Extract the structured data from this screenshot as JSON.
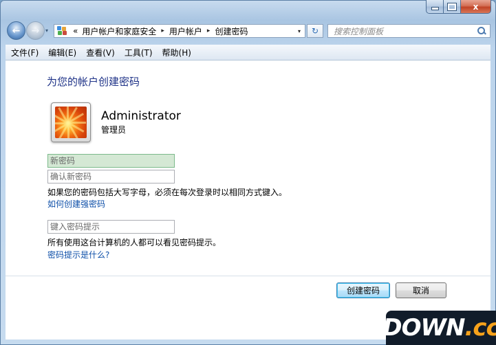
{
  "window": {
    "caption_buttons": {
      "minimize_icon": "minimize-icon",
      "maximize_icon": "maximize-icon",
      "close_glyph": "x"
    }
  },
  "nav": {
    "back_glyph": "←",
    "forward_glyph": "→",
    "recent_glyph": "▾",
    "overflow_glyph": "«",
    "breadcrumbs": [
      "用户帐户和家庭安全",
      "用户帐户",
      "创建密码"
    ],
    "crumb_separator": "▸",
    "dropdown_glyph": "▾",
    "refresh_glyph": "↻",
    "search_placeholder": "搜索控制面板"
  },
  "menu": {
    "items": [
      "文件(F)",
      "编辑(E)",
      "查看(V)",
      "工具(T)",
      "帮助(H)"
    ]
  },
  "main": {
    "heading": "为您的帐户创建密码",
    "user": {
      "name": "Administrator",
      "role": "管理员"
    },
    "fields": {
      "new_password_placeholder": "新密码",
      "confirm_password_placeholder": "确认新密码",
      "hint_placeholder": "键入密码提示"
    },
    "caps_note": "如果您的密码包括大写字母，必须在每次登录时以相同方式键入。",
    "strong_password_link": "如何创建强密码",
    "hint_note": "所有使用这台计算机的人都可以看见密码提示。",
    "hint_link": "密码提示是什么?",
    "buttons": {
      "create": "创建密码",
      "cancel": "取消"
    }
  },
  "watermark": {
    "text": "DOWN",
    "accent": ".cc"
  },
  "colors": {
    "heading": "#1e3287",
    "link": "#0e4fa8",
    "active_field": "#d4e8d4",
    "close_button": "#c04326"
  }
}
